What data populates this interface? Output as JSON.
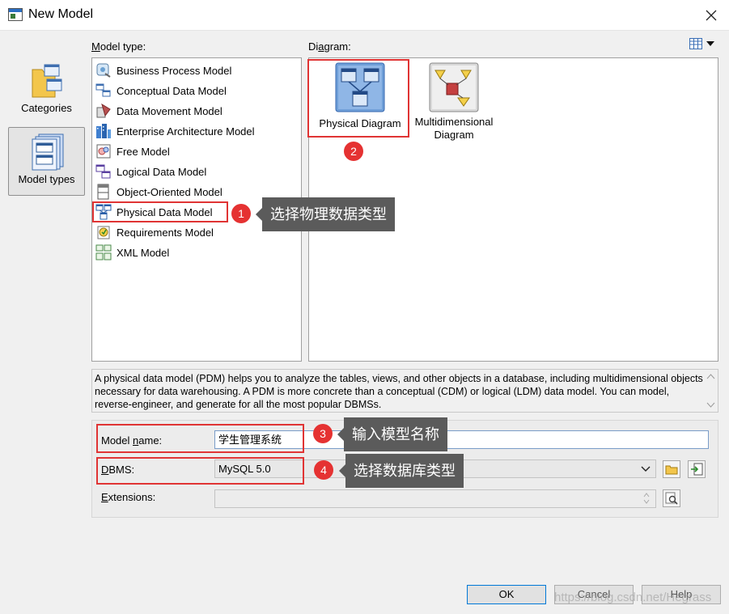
{
  "window": {
    "title": "New Model",
    "icon": "model-window-icon"
  },
  "sidebar": {
    "items": [
      {
        "label": "Categories",
        "icon": "categories-folder-icon"
      },
      {
        "label": "Model types",
        "icon": "model-types-icon",
        "selected": true
      }
    ]
  },
  "model_type": {
    "label": "Model type:",
    "items": [
      {
        "label": "Business Process Model",
        "icon": "business-process-icon"
      },
      {
        "label": "Conceptual Data Model",
        "icon": "conceptual-data-icon"
      },
      {
        "label": "Data Movement Model",
        "icon": "data-movement-icon"
      },
      {
        "label": "Enterprise Architecture Model",
        "icon": "enterprise-architecture-icon"
      },
      {
        "label": "Free Model",
        "icon": "free-model-icon"
      },
      {
        "label": "Logical Data Model",
        "icon": "logical-data-icon"
      },
      {
        "label": "Object-Oriented Model",
        "icon": "object-oriented-icon"
      },
      {
        "label": "Physical Data Model",
        "icon": "physical-data-icon",
        "selected": true
      },
      {
        "label": "Requirements Model",
        "icon": "requirements-icon"
      },
      {
        "label": "XML Model",
        "icon": "xml-model-icon"
      }
    ]
  },
  "diagram": {
    "label": "Diagram:",
    "items": [
      {
        "label": "Physical Diagram",
        "icon": "physical-diagram-icon",
        "selected": true
      },
      {
        "label_line1": "Multidimensional",
        "label_line2": "Diagram",
        "icon": "multidimensional-diagram-icon"
      }
    ]
  },
  "description": "A physical data model (PDM) helps you to analyze the tables, views, and other objects in a database, including multidimensional objects necessary for data warehousing. A PDM is more concrete than a conceptual (CDM) or logical (LDM) data model. You can model, reverse-engineer, and generate for all the most popular DBMSs.",
  "form": {
    "model_name_label": "Model name:",
    "model_name_value": "学生管理系统",
    "dbms_label": "DBMS:",
    "dbms_value": "MySQL 5.0",
    "extensions_label": "Extensions:",
    "extensions_value": ""
  },
  "buttons": {
    "ok": "OK",
    "cancel": "Cancel",
    "help": "Help"
  },
  "annotations": [
    {
      "num": "1",
      "text": "选择物理数据类型"
    },
    {
      "num": "2",
      "text": ""
    },
    {
      "num": "3",
      "text": "输入模型名称"
    },
    {
      "num": "4",
      "text": "选择数据库类型"
    }
  ],
  "watermark": "https://blog.csdn.net/Hegrass",
  "colors": {
    "highlight": "#e03434",
    "tooltip_bg": "#5b5b5b",
    "ok_border": "#0078d7"
  }
}
